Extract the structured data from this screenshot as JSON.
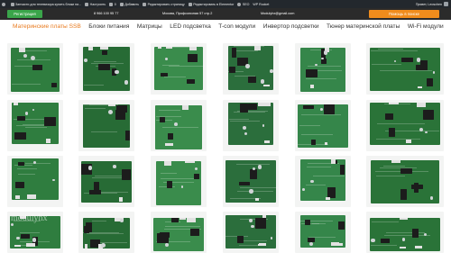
{
  "admin_bar": {
    "items": [
      "Запчасти для телевизора купить блоки пи...",
      "Настроить",
      "0",
      "Добавить",
      "Редактировать страницу",
      "Редактировать в Elementor",
      "SEO",
      "WP Rocket"
    ],
    "greeting": "Привет, Leoschen"
  },
  "header": {
    "register_label": "Регистрация",
    "phone": "8 966 100 95 77",
    "address": "Москва, Профсоюзная 57 стр.2",
    "email": "Modulyhx@gmail.com",
    "help_label": "Помощь в поиске"
  },
  "categories": [
    {
      "label": "Материнские платы SSB",
      "active": true
    },
    {
      "label": "Блоки питания",
      "active": false
    },
    {
      "label": "Матрицы",
      "active": false
    },
    {
      "label": "LED подсветка",
      "active": false
    },
    {
      "label": "T-con модули",
      "active": false
    },
    {
      "label": "Инвертор подсветки",
      "active": false
    },
    {
      "label": "Тюнер материнской платы",
      "active": false
    },
    {
      "label": "Wi-Fi модули",
      "active": false
    }
  ],
  "watermark": "modulyhx",
  "colors": {
    "admin_bar_bg": "#23282d",
    "header_bg": "#2b2b2b",
    "register_green": "#3aa54a",
    "help_orange": "#f08c1c",
    "active_tab": "#e87a1e",
    "board_green": "#2f7d3f"
  },
  "products": [
    {
      "name": "main-board-1"
    },
    {
      "name": "main-board-2"
    },
    {
      "name": "main-board-3"
    },
    {
      "name": "main-board-4"
    },
    {
      "name": "main-board-5"
    },
    {
      "name": "main-board-6"
    },
    {
      "name": "main-board-7"
    },
    {
      "name": "main-board-8"
    },
    {
      "name": "main-board-9"
    },
    {
      "name": "main-board-10"
    },
    {
      "name": "main-board-11"
    },
    {
      "name": "main-board-12"
    },
    {
      "name": "main-board-13"
    },
    {
      "name": "main-board-14"
    },
    {
      "name": "main-board-15"
    },
    {
      "name": "main-board-16"
    },
    {
      "name": "main-board-17"
    },
    {
      "name": "main-board-18"
    },
    {
      "name": "main-board-19"
    },
    {
      "name": "main-board-20"
    },
    {
      "name": "main-board-21"
    },
    {
      "name": "main-board-22"
    },
    {
      "name": "main-board-23"
    },
    {
      "name": "main-board-24"
    },
    {
      "name": "main-board-25"
    },
    {
      "name": "main-board-26"
    },
    {
      "name": "main-board-27"
    },
    {
      "name": "main-board-28"
    },
    {
      "name": "main-board-29"
    },
    {
      "name": "main-board-30"
    },
    {
      "name": "main-board-31"
    },
    {
      "name": "main-board-32"
    }
  ]
}
